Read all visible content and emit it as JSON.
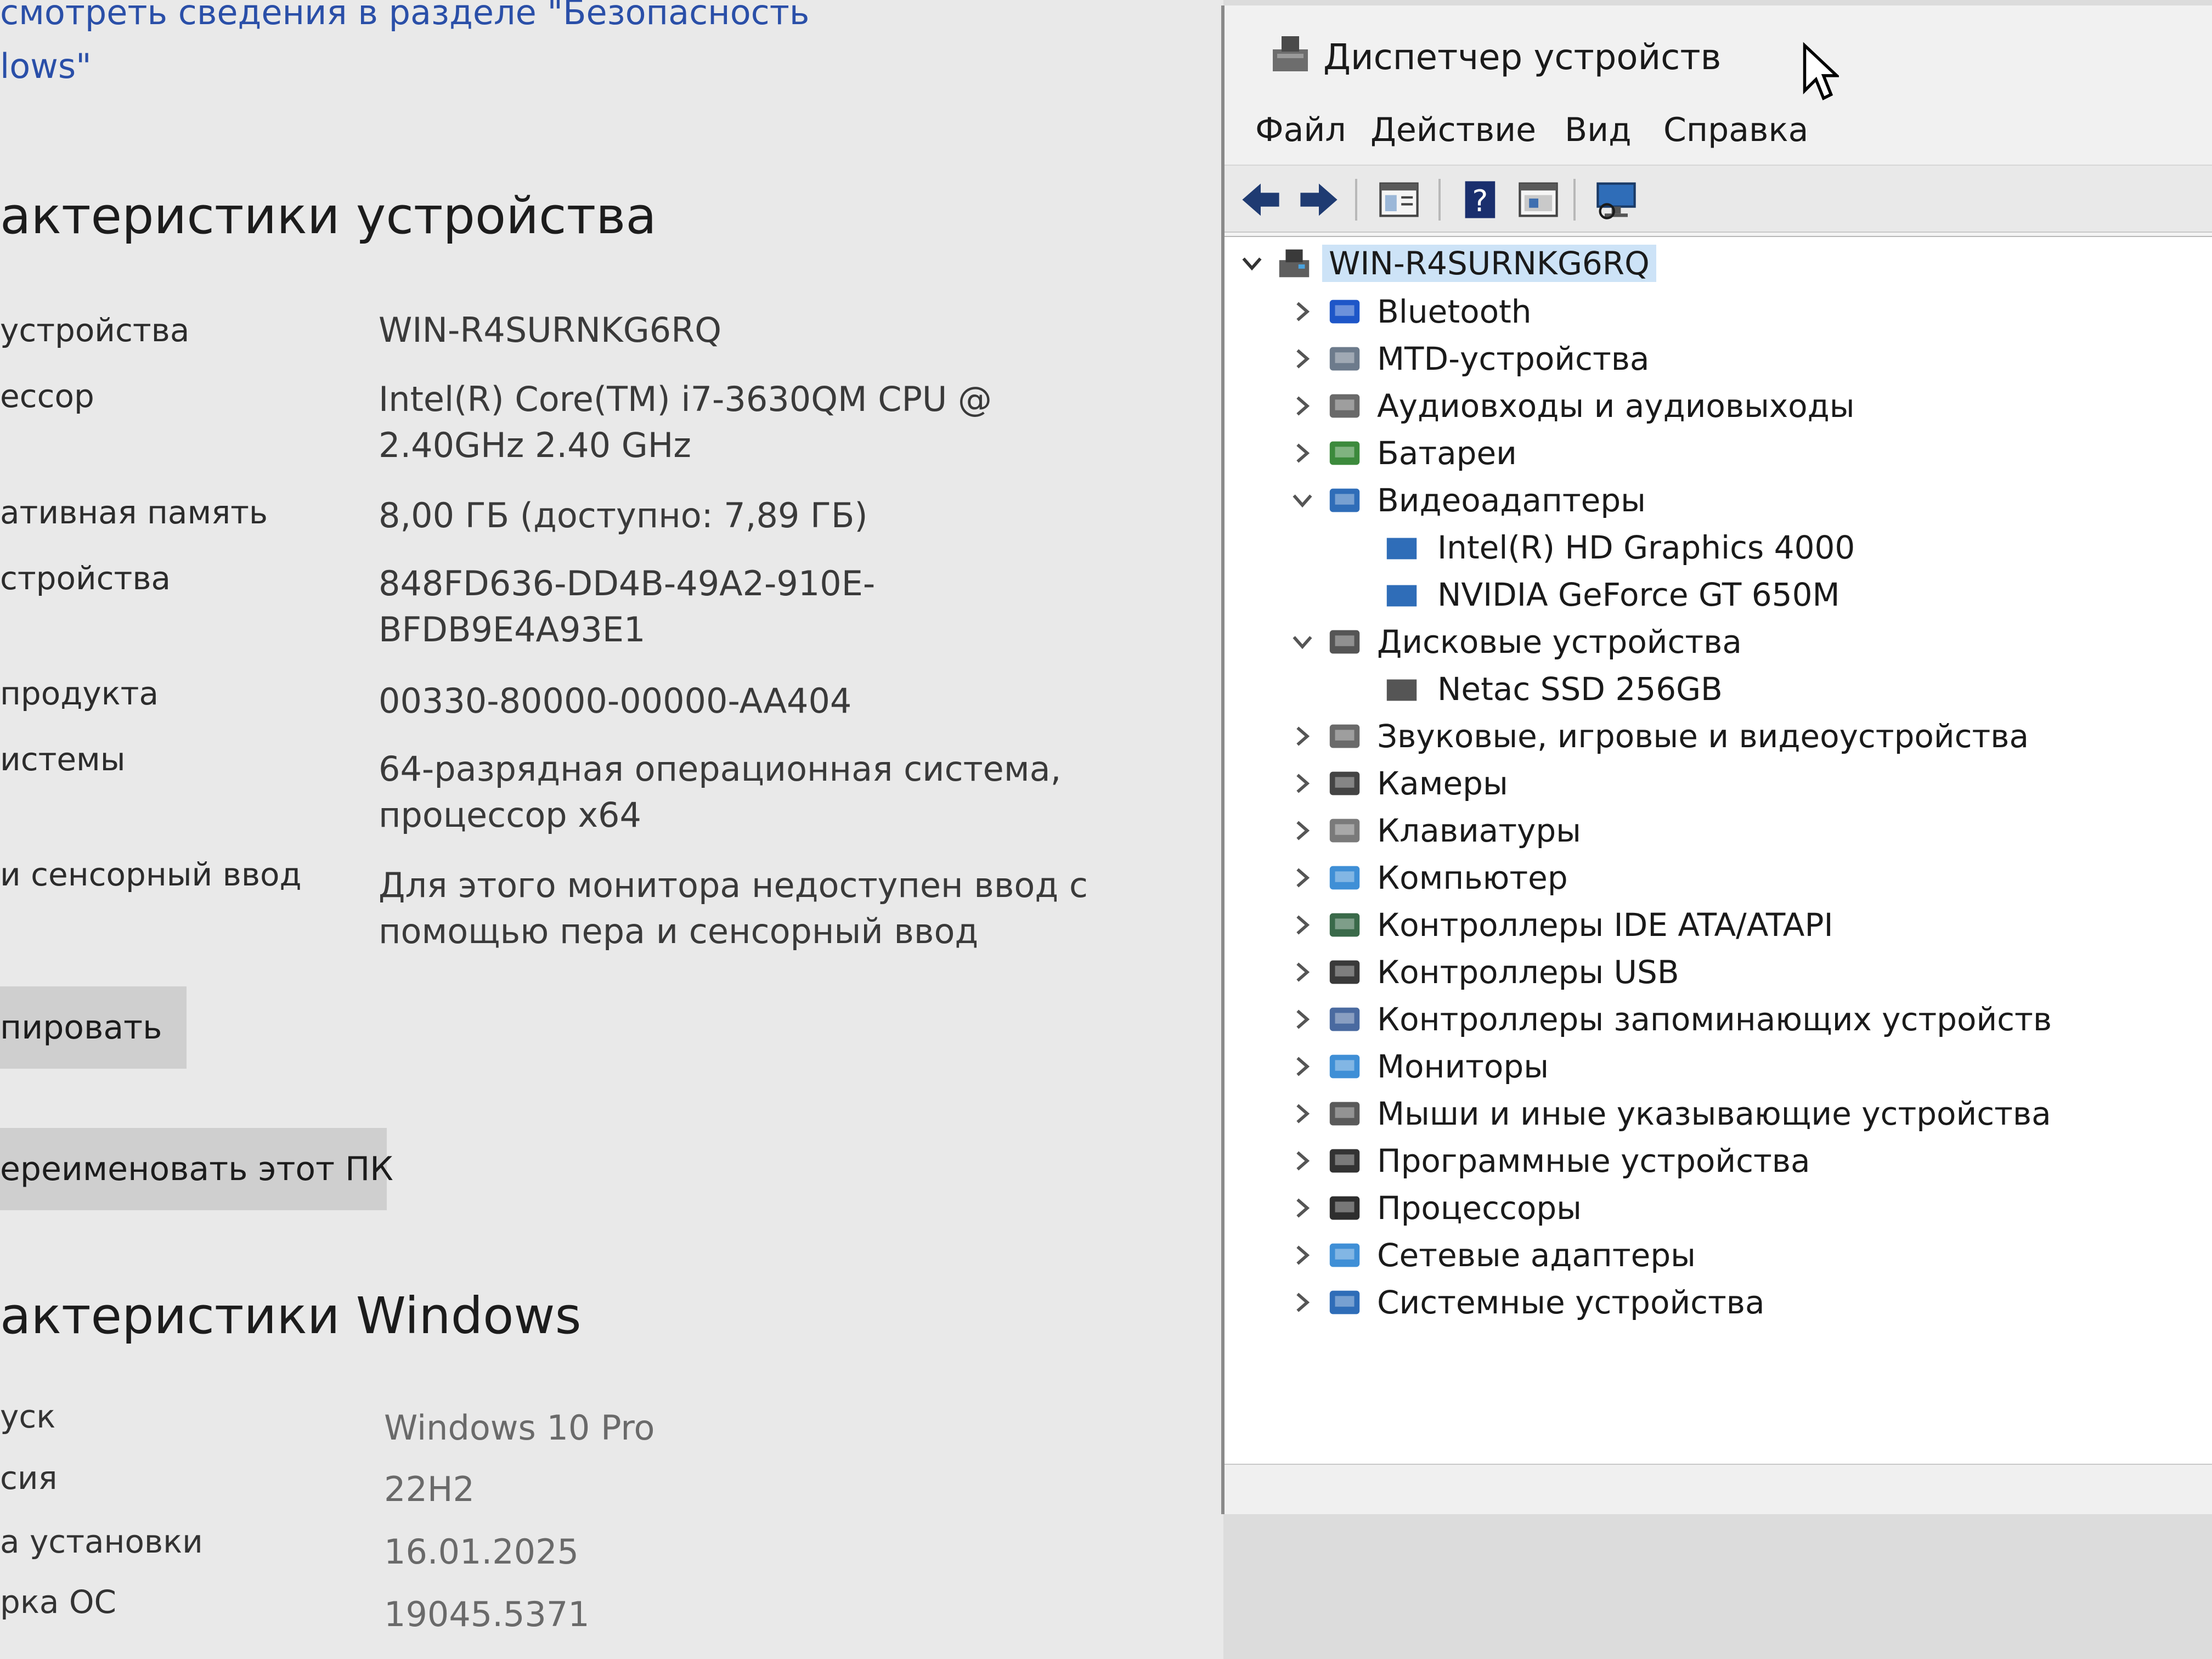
{
  "settings": {
    "security_link_line1": "смотреть сведения в разделе \"Безопасность",
    "security_link_line2": "lows\"",
    "device_specs_title": "актеристики устройства",
    "specs": [
      {
        "label": "устройства",
        "value": "WIN-R4SURNKG6RQ"
      },
      {
        "label": "ессор",
        "value_line1": "Intel(R) Core(TM) i7-3630QM CPU @",
        "value_line2": "2.40GHz   2.40 GHz"
      },
      {
        "label": "ативная память",
        "value": "8,00 ГБ (доступно: 7,89 ГБ)"
      },
      {
        "label": "стройства",
        "value_line1": "848FD636-DD4B-49A2-910E-",
        "value_line2": "BFDB9E4A93E1"
      },
      {
        "label": "продукта",
        "value": "00330-80000-00000-AA404"
      },
      {
        "label": "истемы",
        "value_line1": "64-разрядная операционная система,",
        "value_line2": "процессор x64"
      },
      {
        "label": "и сенсорный ввод",
        "value_line1": "Для этого монитора недоступен ввод с",
        "value_line2": "помощью пера и сенсорный ввод"
      }
    ],
    "copy_button": "пировать",
    "rename_button": "ереименовать этот ПК",
    "windows_specs_title": "актеристики Windows",
    "windows": [
      {
        "label": "уск",
        "value": "Windows 10 Pro"
      },
      {
        "label": "сия",
        "value": "22H2"
      },
      {
        "label": "а установки",
        "value": "16.01.2025"
      },
      {
        "label": "рка ОС",
        "value": "19045.5371"
      }
    ]
  },
  "device_manager": {
    "title": "Диспетчер устройств",
    "menu": [
      "Файл",
      "Действие",
      "Вид",
      "Справка"
    ],
    "toolbar_icons": [
      "back-icon",
      "forward-icon",
      "properties-icon",
      "help-icon",
      "update-driver-icon",
      "monitor-scan-icon"
    ],
    "root": "WIN-R4SURNKG6RQ",
    "tree": [
      {
        "label": "Bluetooth",
        "expanded": false,
        "icon": "bluetooth-icon"
      },
      {
        "label": "MTD-устройства",
        "expanded": false,
        "icon": "mtd-icon"
      },
      {
        "label": "Аудиовходы и аудиовыходы",
        "expanded": false,
        "icon": "speaker-icon"
      },
      {
        "label": "Батареи",
        "expanded": false,
        "icon": "battery-icon"
      },
      {
        "label": "Видеоадаптеры",
        "expanded": true,
        "icon": "display-adapter-icon",
        "children": [
          "Intel(R) HD Graphics 4000",
          "NVIDIA GeForce GT 650M"
        ]
      },
      {
        "label": "Дисковые устройства",
        "expanded": true,
        "icon": "disk-icon",
        "children": [
          "Netac SSD 256GB"
        ]
      },
      {
        "label": "Звуковые, игровые и видеоустройства",
        "expanded": false,
        "icon": "sound-icon"
      },
      {
        "label": "Камеры",
        "expanded": false,
        "icon": "camera-icon"
      },
      {
        "label": "Клавиатуры",
        "expanded": false,
        "icon": "keyboard-icon"
      },
      {
        "label": "Компьютер",
        "expanded": false,
        "icon": "computer-icon"
      },
      {
        "label": "Контроллеры IDE ATA/ATAPI",
        "expanded": false,
        "icon": "ide-icon"
      },
      {
        "label": "Контроллеры USB",
        "expanded": false,
        "icon": "usb-icon"
      },
      {
        "label": "Контроллеры запоминающих устройств",
        "expanded": false,
        "icon": "storage-controller-icon"
      },
      {
        "label": "Мониторы",
        "expanded": false,
        "icon": "monitor-icon"
      },
      {
        "label": "Мыши и иные указывающие устройства",
        "expanded": false,
        "icon": "mouse-icon"
      },
      {
        "label": "Программные устройства",
        "expanded": false,
        "icon": "software-device-icon"
      },
      {
        "label": "Процессоры",
        "expanded": false,
        "icon": "processor-icon"
      },
      {
        "label": "Сетевые адаптеры",
        "expanded": false,
        "icon": "network-adapter-icon"
      },
      {
        "label": "Системные устройства",
        "expanded": false,
        "icon": "system-devices-icon"
      }
    ]
  }
}
